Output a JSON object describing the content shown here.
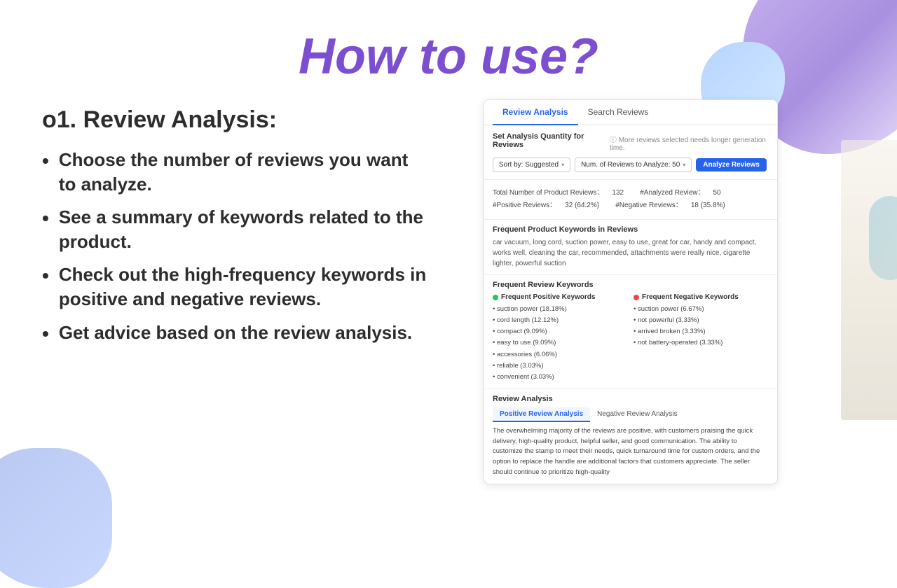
{
  "header": {
    "title": "How to use?"
  },
  "left": {
    "section_title": "o1. Review Analysis:",
    "bullets": [
      "Choose the number of reviews you want to analyze.",
      "See a summary of keywords related to the product.",
      "Check out the high-frequency keywords in positive and negative reviews.",
      "Get advice based on the review analysis."
    ]
  },
  "ui": {
    "tabs": [
      {
        "label": "Review Analysis",
        "active": true
      },
      {
        "label": "Search Reviews",
        "active": false
      }
    ],
    "analysis_quantity": {
      "title": "Set Analysis Quantity for Reviews",
      "hint": "ⓘ More reviews selected needs longer generation time.",
      "sort_by": "Sort by: Suggested",
      "num_reviews": "Num. of Reviews to Analyze:  50",
      "analyze_btn": "Analyze Reviews"
    },
    "stats": {
      "total_label": "Total Number of Product Reviews：",
      "total_val": "132",
      "analyzed_label": "#Analyzed Review：",
      "analyzed_val": "50",
      "positive_label": "#Positive Reviews：",
      "positive_val": "32 (64.2%)",
      "negative_label": "#Negative Reviews：",
      "negative_val": "18 (35.8%)"
    },
    "product_keywords": {
      "title": "Frequent Product Keywords in Reviews",
      "text": "car vacuum, long cord, suction power, easy to use, great for car, handy and compact, works well, cleaning the car, recommended, attachments were really nice, cigarette lighter, powerful suction"
    },
    "frequent_keywords": {
      "title": "Frequent Review Keywords",
      "positive_title": "Frequent Positive Keywords",
      "positive_items": [
        "suction power (18.18%)",
        "cord length (12.12%)",
        "compact (9.09%)",
        "easy to use (9.09%)",
        "accessories (6.06%)",
        "reliable (3.03%)",
        "convenient (3.03%)"
      ],
      "negative_title": "Frequent Negative Keywords",
      "negative_items": [
        "suction power (6.67%)",
        "not powerful (3.33%)",
        "arrived broken (3.33%)",
        "not battery-operated (3.33%)"
      ]
    },
    "review_analysis": {
      "title": "Review Analysis",
      "tabs": [
        {
          "label": "Positive Review Analysis",
          "active": true
        },
        {
          "label": "Negative Review Analysis",
          "active": false
        }
      ],
      "content": "The overwhelming majority of the reviews are positive, with customers praising the quick delivery, high-quality product, helpful seller, and good communication. The ability to customize the stamp to meet their needs, quick turnaround time for custom orders, and the option to replace the handle are additional factors that customers appreciate. The seller should continue to prioritize high-quality"
    }
  }
}
